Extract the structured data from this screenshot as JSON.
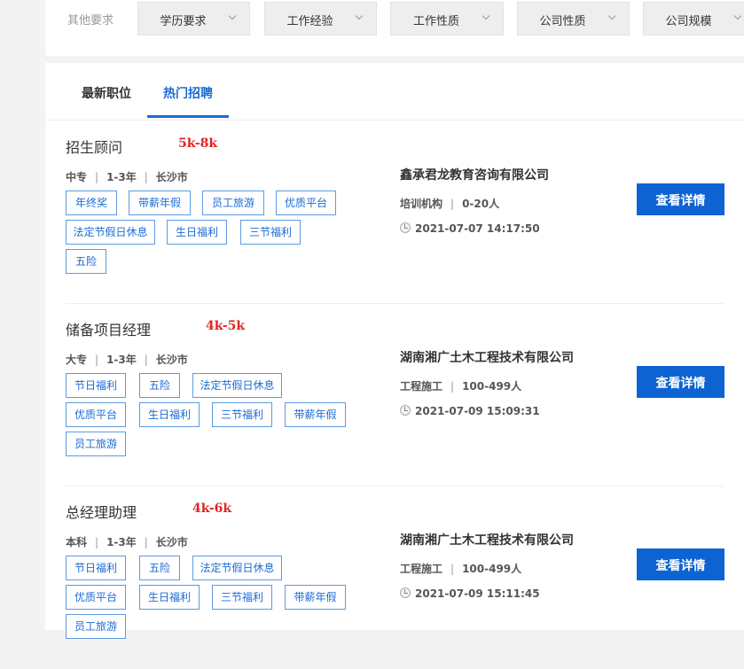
{
  "filters": {
    "label": "其他要求",
    "dropdowns": [
      "学历要求",
      "工作经验",
      "工作性质",
      "公司性质",
      "公司规模"
    ]
  },
  "tabs": [
    {
      "label": "最新职位"
    },
    {
      "label": "热门招聘"
    }
  ],
  "jobs": [
    {
      "title": "招生顾问",
      "salary": "5k-8k",
      "education": "中专",
      "experience": "1-3年",
      "city": "长沙市",
      "tags": [
        "年终奖",
        "带薪年假",
        "员工旅游",
        "优质平台",
        "法定节假日休息",
        "生日福利",
        "三节福利",
        "五险"
      ],
      "company": "鑫承君龙教育咨询有限公司",
      "industry": "培训机构",
      "size": "0-20人",
      "time": "2021-07-07 14:17:50",
      "button": "查看详情"
    },
    {
      "title": "储备项目经理",
      "salary": "4k-5k",
      "education": "大专",
      "experience": "1-3年",
      "city": "长沙市",
      "tags": [
        "节日福利",
        "五险",
        "法定节假日休息",
        "优质平台",
        "生日福利",
        "三节福利",
        "带薪年假",
        "员工旅游"
      ],
      "company": "湖南湘广土木工程技术有限公司",
      "industry": "工程施工",
      "size": "100-499人",
      "time": "2021-07-09 15:09:31",
      "button": "查看详情"
    },
    {
      "title": "总经理助理",
      "salary": "4k-6k",
      "education": "本科",
      "experience": "1-3年",
      "city": "长沙市",
      "tags": [
        "节日福利",
        "五险",
        "法定节假日休息",
        "优质平台",
        "生日福利",
        "三节福利",
        "带薪年假",
        "员工旅游"
      ],
      "company": "湖南湘广土木工程技术有限公司",
      "industry": "工程施工",
      "size": "100-499人",
      "time": "2021-07-09 15:11:45",
      "button": "查看详情"
    }
  ]
}
